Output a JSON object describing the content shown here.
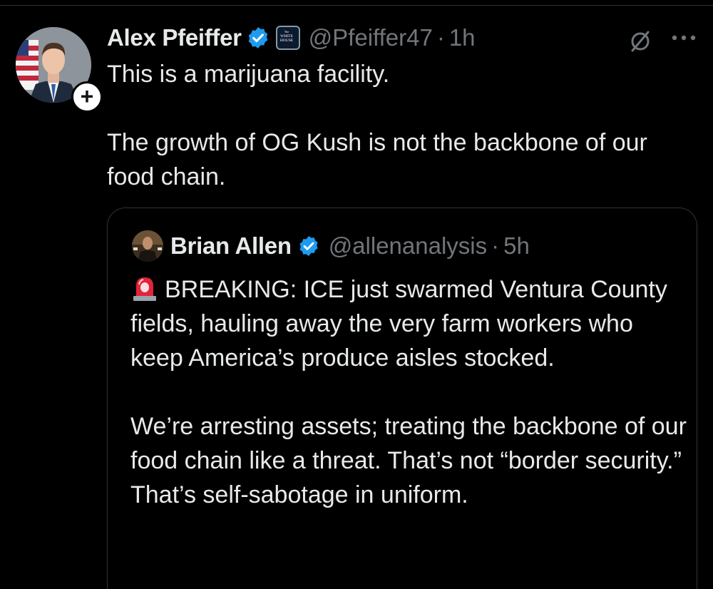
{
  "tweet": {
    "author": {
      "display_name": "Alex Pfeiffer",
      "handle": "@Pfeiffer47",
      "affiliation_badge": "The White House",
      "verified": true
    },
    "separator": "·",
    "time": "1h",
    "follow_icon": "plus-icon",
    "grok_icon": "grok-slash-icon",
    "more_icon": "ellipsis-icon",
    "text": "This is a marijuana facility.\n\nThe growth of OG Kush is not the backbone of our food chain."
  },
  "quoted_tweet": {
    "author": {
      "display_name": "Brian Allen",
      "handle": "@allenanalysis",
      "verified": true
    },
    "separator": "·",
    "time": "5h",
    "emoji": "siren-icon",
    "text": "BREAKING: ICE just swarmed Ventura County fields, hauling away the very farm workers who keep America’s produce aisles stocked.\n\nWe’re arresting assets; treating the backbone of our food chain like a threat. That’s not “border security.” That’s self-sabotage in uniform."
  },
  "colors": {
    "background": "#000000",
    "primary_text": "#e7e9ea",
    "secondary_text": "#71767b",
    "verified_blue": "#1d9bf0",
    "border": "#2f3336"
  }
}
